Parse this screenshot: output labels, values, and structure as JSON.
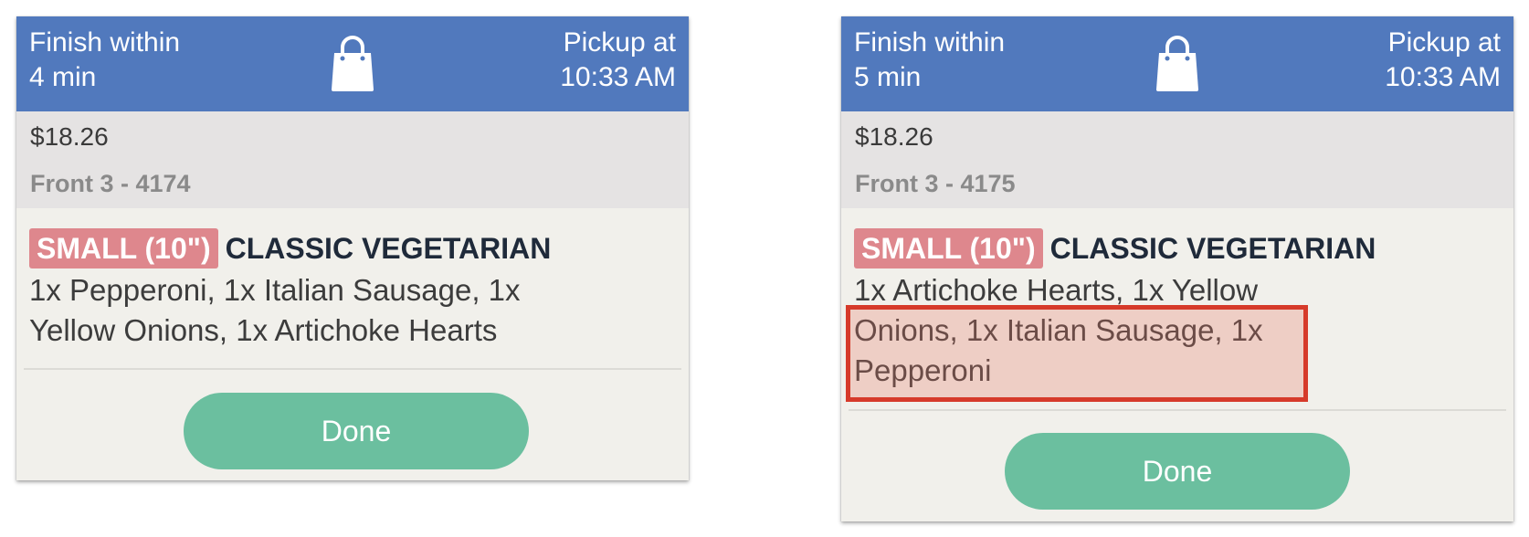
{
  "cards": [
    {
      "header": {
        "finish_line1": "Finish within",
        "finish_line2": "4 min",
        "pickup_line1": "Pickup at",
        "pickup_line2": "10:33 AM",
        "icon": "shopping-bag-icon"
      },
      "price": "$18.26",
      "location": "Front 3 - 4174",
      "item": {
        "size": "SMALL (10\")",
        "name": "CLASSIC VEGETARIAN",
        "toppings_lines": [
          "1x Pepperoni, 1x Italian Sausage, 1x",
          "Yellow Onions, 1x Artichoke Hearts"
        ]
      },
      "done_label": "Done"
    },
    {
      "header": {
        "finish_line1": "Finish within",
        "finish_line2": "5 min",
        "pickup_line1": "Pickup at",
        "pickup_line2": "10:33 AM",
        "icon": "shopping-bag-icon"
      },
      "price": "$18.26",
      "location": "Front 3 - 4175",
      "item": {
        "size": "SMALL (10\")",
        "name": "CLASSIC VEGETARIAN",
        "toppings_lines": [
          "1x Artichoke Hearts, 1x Yellow",
          "Onions, 1x Italian Sausage, 1x",
          "Pepperoni"
        ]
      },
      "done_label": "Done"
    }
  ],
  "colors": {
    "header_bg": "#5179bd",
    "info_bg": "#e5e3e3",
    "body_bg": "#f1f0eb",
    "size_badge": "#de878d",
    "done_button": "#6bbf9f",
    "highlight_border": "#d63a2a"
  }
}
